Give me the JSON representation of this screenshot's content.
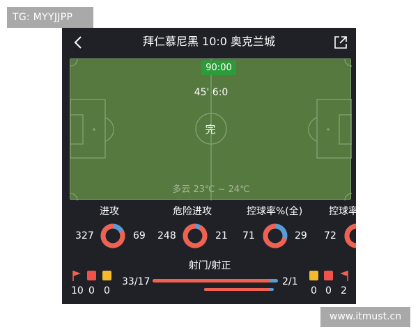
{
  "watermark_top": "TG: MYYJJPP",
  "watermark_bottom": "www.itmust.cn",
  "header": {
    "title": "拜仁慕尼黑   10:0   奥克兰城",
    "back_icon": "back-arrow-icon",
    "share_icon": "share-icon"
  },
  "pitch": {
    "clock": "90:00",
    "half_score": "45' 6:0",
    "status": "完",
    "weather": "多云 23℃ ~ 24℃"
  },
  "stats": [
    {
      "label": "进攻",
      "home": "327",
      "away": "69",
      "home_share": 0.83
    },
    {
      "label": "危险进攻",
      "home": "248",
      "away": "21",
      "home_share": 0.92
    },
    {
      "label": "控球率%(全)",
      "home": "71",
      "away": "29",
      "home_share": 0.71
    },
    {
      "label": "控球率",
      "home": "72",
      "away": "",
      "home_share": 0.72
    }
  ],
  "shots": {
    "label": "射门/射正",
    "home": "33/17",
    "away": "2/1",
    "shots_home_share": 0.94,
    "on_target_home_share": 0.94
  },
  "cards": {
    "home": {
      "corners": "10",
      "red": "0",
      "yellow": "0"
    },
    "away": {
      "yellow": "0",
      "red": "0",
      "corners": "2"
    }
  },
  "colors": {
    "home": "#f0624f",
    "away": "#5b9bd5",
    "pitch": "#55793f",
    "clock_bg": "#2c9c3a",
    "red_card": "#f0524a",
    "yellow_card": "#f5b92e"
  }
}
